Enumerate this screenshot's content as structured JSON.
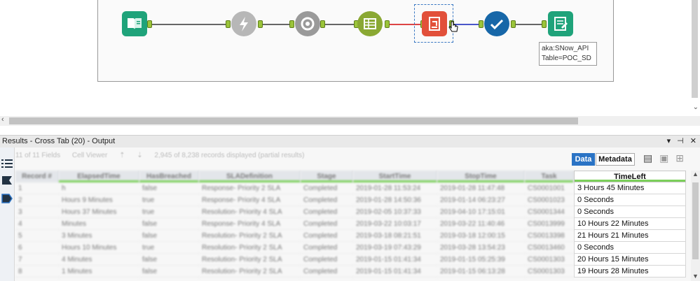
{
  "canvas": {
    "tools": [
      {
        "name": "input-data-tool",
        "color": "#1fa37a"
      },
      {
        "name": "formula-tool",
        "color": "#b7b7b7"
      },
      {
        "name": "join-tool",
        "color": "#9a9a9a"
      },
      {
        "name": "cross-tab-tool",
        "color": "#8aa833"
      },
      {
        "name": "transform-tool",
        "color": "#e2503a"
      },
      {
        "name": "validation-tool",
        "color": "#1767a8"
      },
      {
        "name": "output-data-tool",
        "color": "#1fa37a"
      }
    ],
    "annotation": [
      "aka:SNow_API",
      "Table=POC_SD"
    ]
  },
  "results": {
    "title": "Results - Cross Tab (20) - Output",
    "title_controls": "▾ ⊣ ✕",
    "toolbar": {
      "fields": "11 of 11 Fields",
      "cell_viewer": "Cell Viewer",
      "records_info": "2,945 of 8,238 records displayed (partial results)"
    },
    "tabs": {
      "data": "Data",
      "metadata": "Metadata"
    },
    "columns": [
      "Record #",
      "ElapsedTime",
      "HasBreached",
      "SLADefinition",
      "Stage",
      "StartTime",
      "StopTime",
      "Task",
      "TimeLeft"
    ],
    "rows": [
      [
        "1",
        "h",
        "false",
        "Response- Priority 2 SLA",
        "Completed",
        "2019-01-28 11:53:24",
        "2019-01-28 11:47:48",
        "CS0001001",
        "3 Hours 45 Minutes"
      ],
      [
        "2",
        "Hours 9 Minutes",
        "true",
        "Response- Priority 4 SLA",
        "Completed",
        "2019-01-28 14:50:36",
        "2019-01-14 06:23:27",
        "CS0001023",
        "0 Seconds"
      ],
      [
        "3",
        "Hours 37 Minutes",
        "true",
        "Resolution- Priority 4 SLA",
        "Completed",
        "2019-02-05 10:37:33",
        "2019-04-10 17:15:01",
        "CS0001344",
        "0 Seconds"
      ],
      [
        "4",
        "Minutes",
        "false",
        "Response- Priority 4 SLA",
        "Completed",
        "2019-03-22 10:03:17",
        "2019-03-22 11:40:46",
        "CS0013999",
        "10 Hours 22 Minutes"
      ],
      [
        "5",
        "3 Minutes",
        "false",
        "Resolution- Priority 2 SLA",
        "Completed",
        "2019-03-18 08:21:51",
        "2019-03-18 12:00:15",
        "CS0013398",
        "21 Hours 21 Minutes"
      ],
      [
        "6",
        "Hours 10 Minutes",
        "true",
        "Resolution- Priority 2 SLA",
        "Completed",
        "2019-03-19 07:43:29",
        "2019-03-28 13:54:23",
        "CS0013460",
        "0 Seconds"
      ],
      [
        "7",
        "4 Minutes",
        "false",
        "Resolution- Priority 2 SLA",
        "Completed",
        "2019-01-15 01:41:34",
        "2019-01-15 05:25:39",
        "CS0001303",
        "20 Hours 15 Minutes"
      ],
      [
        "8",
        "1 Minutes",
        "false",
        "Resolution- Priority 2 SLA",
        "Completed",
        "2019-01-15 01:41:34",
        "2019-01-15 06:13:28",
        "CS0001303",
        "19 Hours 28 Minutes"
      ]
    ]
  }
}
